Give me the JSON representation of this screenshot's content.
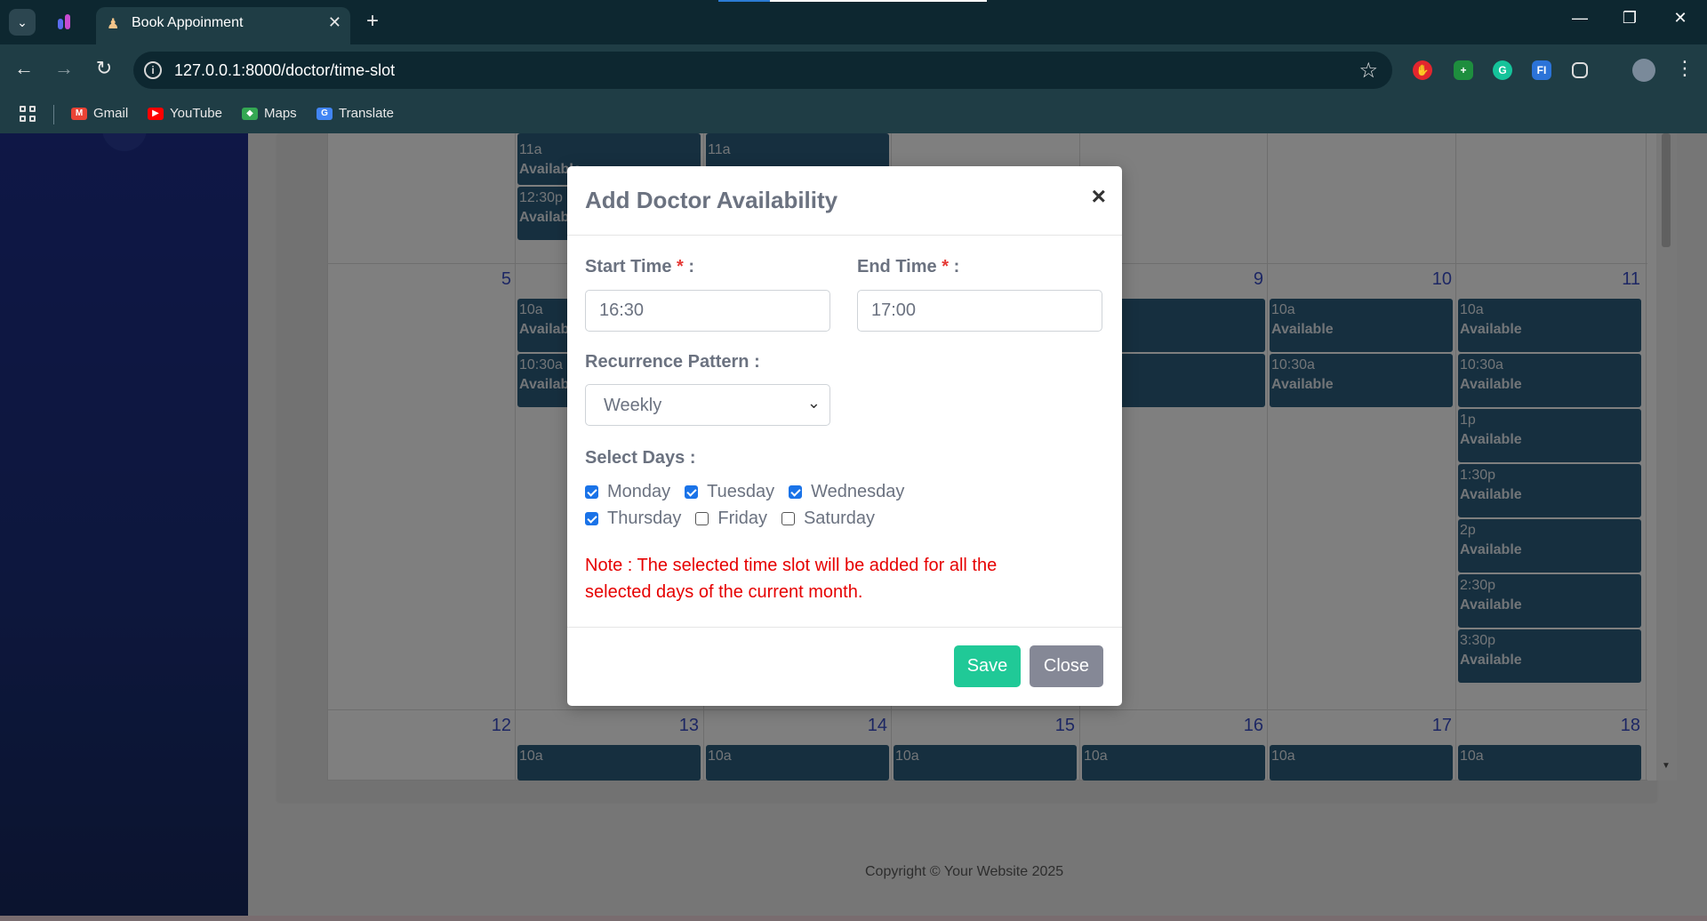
{
  "browser": {
    "tab_title": "Book Appoinment",
    "url": "127.0.0.1:8000/doctor/time-slot",
    "bookmarks": [
      {
        "label": "Gmail",
        "icon": "gmail-icon",
        "color": "#ea4335"
      },
      {
        "label": "YouTube",
        "icon": "youtube-icon",
        "color": "#ff0000"
      },
      {
        "label": "Maps",
        "icon": "maps-icon",
        "color": "#34a853"
      },
      {
        "label": "Translate",
        "icon": "translate-icon",
        "color": "#4285f4"
      }
    ]
  },
  "calendar": {
    "week2_days": [
      "5",
      "9",
      "10",
      "11"
    ],
    "week3_days": [
      "12",
      "13",
      "14",
      "15",
      "16",
      "17",
      "18"
    ],
    "slot_status": "Available",
    "week1_slots": {
      "col2": [
        "11a",
        "12:30p"
      ],
      "col3": [
        "11a"
      ]
    },
    "week2_slots": {
      "col2": [
        "10a",
        "10:30a"
      ],
      "col5": [
        "",
        ""
      ],
      "col6": [
        "10a",
        "10:30a"
      ],
      "col7": [
        "10a",
        "10:30a",
        "1p",
        "1:30p",
        "2p",
        "2:30p",
        "3:30p"
      ]
    },
    "week3_slot_time": "10a"
  },
  "footer": {
    "copyright": "Copyright © Your Website 2025"
  },
  "modal": {
    "title": "Add Doctor Availability",
    "close_symbol": "×",
    "start_time_label": "Start Time",
    "end_time_label": "End Time",
    "required_marker": "*",
    "label_suffix": " :",
    "start_time_value": "16:30",
    "end_time_value": "17:00",
    "recurrence_label": "Recurrence Pattern :",
    "recurrence_value": "Weekly",
    "select_days_label": "Select Days :",
    "days": [
      {
        "label": "Monday",
        "checked": true
      },
      {
        "label": "Tuesday",
        "checked": true
      },
      {
        "label": "Wednesday",
        "checked": true
      },
      {
        "label": "Thursday",
        "checked": true
      },
      {
        "label": "Friday",
        "checked": false
      },
      {
        "label": "Saturday",
        "checked": false
      }
    ],
    "note": "Note : The selected time slot will be added for all the selected days of the current month.",
    "save_label": "Save",
    "close_label": "Close"
  },
  "colors": {
    "sidebar": "#1e2f8c",
    "slot": "#2c5f7e",
    "save": "#20c997",
    "close": "#858896",
    "note": "#e60000",
    "checkbox": "#1a73e8"
  }
}
